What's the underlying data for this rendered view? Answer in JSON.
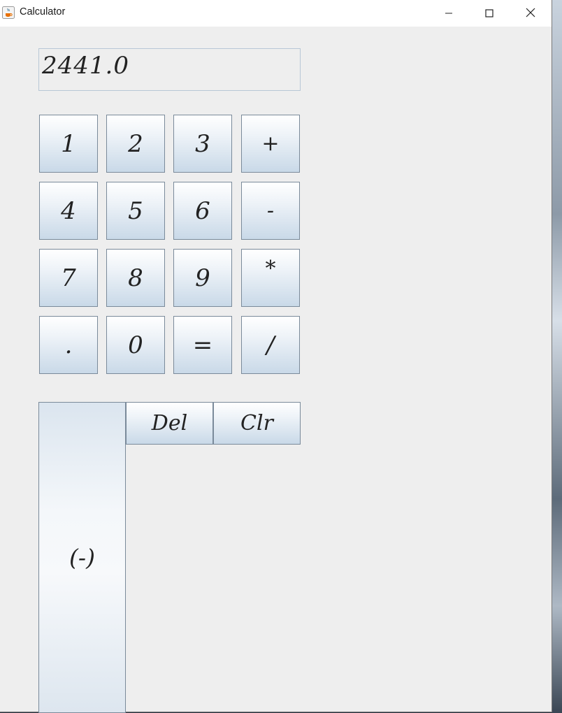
{
  "window": {
    "title": "Calculator",
    "icon": "java-cup-icon",
    "controls": [
      "minimize-icon",
      "maximize-icon",
      "close-icon"
    ]
  },
  "display": {
    "value": "2441.0"
  },
  "keypad": {
    "rows": [
      [
        "1",
        "2",
        "3",
        "+"
      ],
      [
        "4",
        "5",
        "6",
        "-"
      ],
      [
        "7",
        "8",
        "9",
        "*"
      ],
      [
        ".",
        "0",
        "=",
        "/"
      ]
    ]
  },
  "functions": {
    "negate_label": "(-)",
    "delete_label": "Del",
    "clear_label": "Clr"
  },
  "colors": {
    "window_bg": "#eeeeee",
    "button_gradient_top": "#ffffff",
    "button_gradient_bottom": "#c9d9e8",
    "button_border": "#7a8a9a",
    "display_border": "#b8c7d6"
  }
}
